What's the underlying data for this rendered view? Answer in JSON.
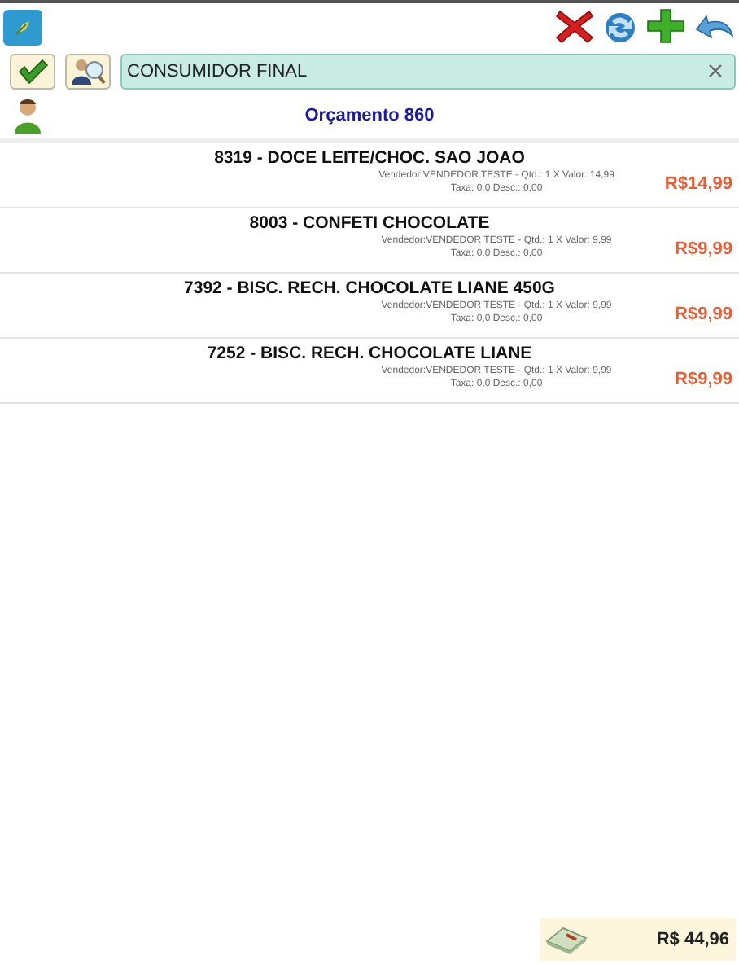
{
  "search": {
    "value": "CONSUMIDOR FINAL"
  },
  "title": "Orçamento 860",
  "items": [
    {
      "name": "8319 - DOCE LEITE/CHOC. SAO JOAO",
      "details": "Vendedor:VENDEDOR TESTE - Qtd.: 1 X Valor: 14,99 Taxa: 0,0 Desc.: 0,00",
      "price": "R$14,99"
    },
    {
      "name": "8003 - CONFETI CHOCOLATE",
      "details": "Vendedor:VENDEDOR TESTE - Qtd.: 1 X Valor: 9,99 Taxa: 0,0 Desc.: 0,00",
      "price": "R$9,99"
    },
    {
      "name": "7392 - BISC. RECH. CHOCOLATE LIANE 450G",
      "details": "Vendedor:VENDEDOR TESTE - Qtd.: 1 X Valor: 9,99 Taxa: 0,0 Desc.: 0,00",
      "price": "R$9,99"
    },
    {
      "name": "7252 - BISC. RECH. CHOCOLATE LIANE",
      "details": "Vendedor:VENDEDOR TESTE - Qtd.: 1 X Valor: 9,99 Taxa: 0,0 Desc.: 0,00",
      "price": "R$9,99"
    }
  ],
  "total": "R$ 44,96"
}
